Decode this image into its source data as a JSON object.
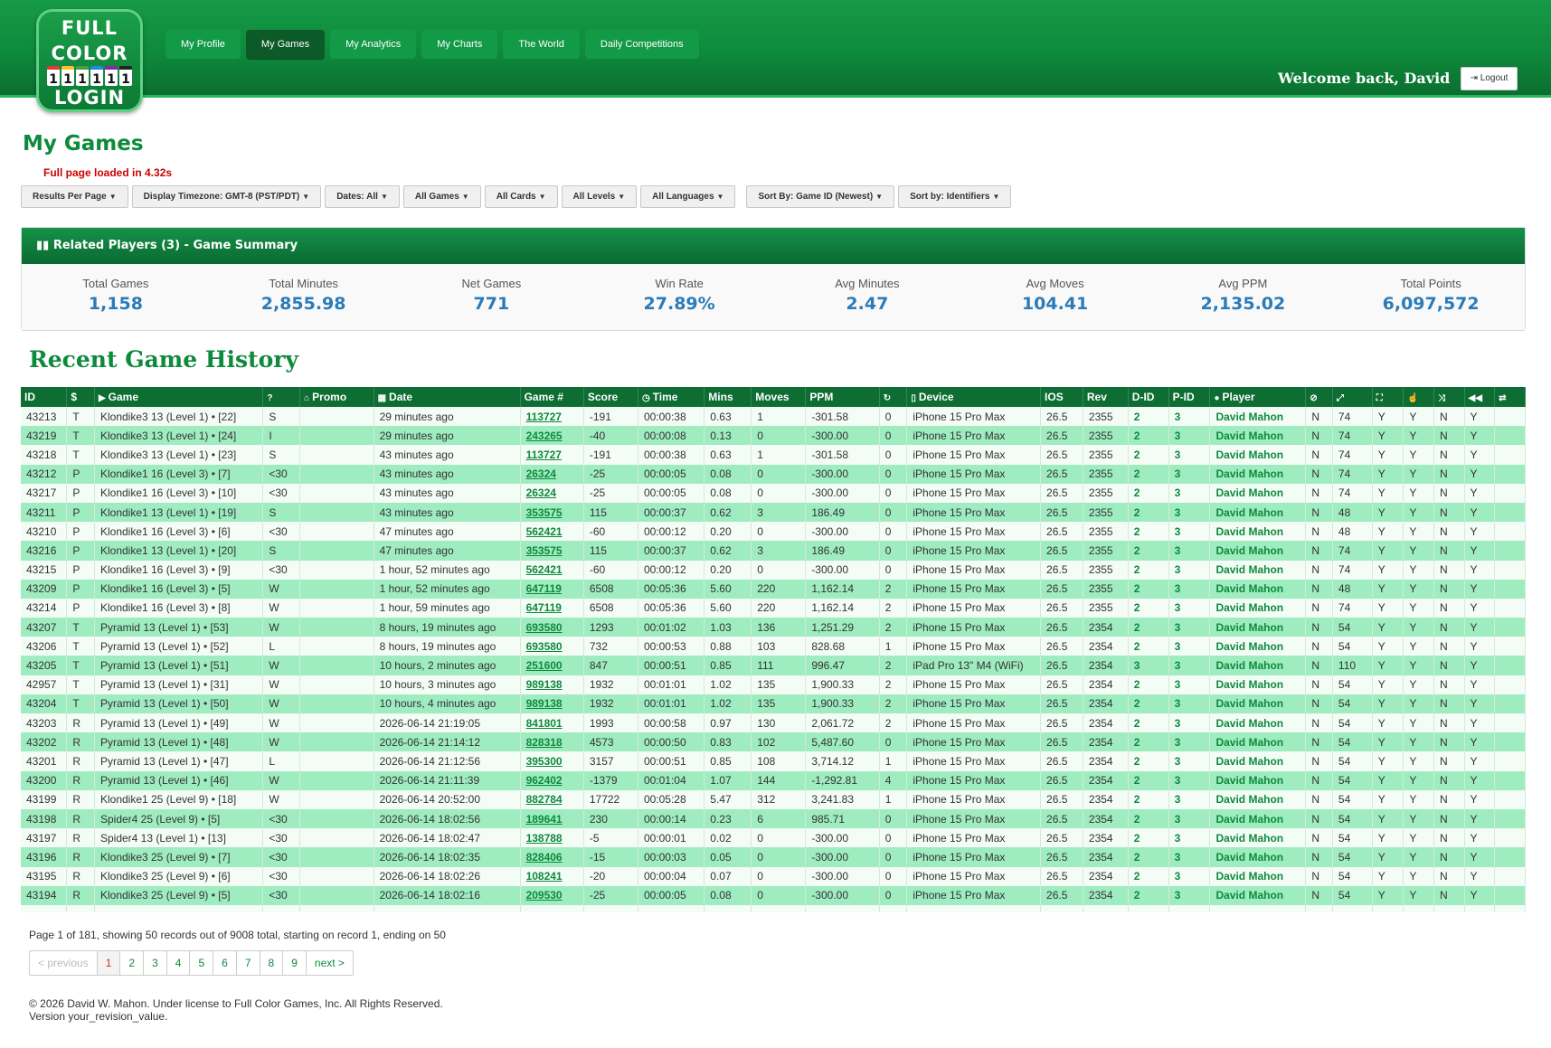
{
  "logo": {
    "line1": "FULL",
    "line2": "COLOR",
    "cards": [
      "1",
      "1",
      "1",
      "1",
      "1",
      "1"
    ],
    "line3": "LOGIN"
  },
  "nav": [
    {
      "label": "My Profile",
      "active": false
    },
    {
      "label": "My Games",
      "active": true
    },
    {
      "label": "My Analytics",
      "active": false
    },
    {
      "label": "My Charts",
      "active": false
    },
    {
      "label": "The World",
      "active": false
    },
    {
      "label": "Daily Competitions",
      "active": false
    }
  ],
  "header": {
    "welcome": "Welcome back, David",
    "logout_label": "Logout"
  },
  "page": {
    "title": "My Games",
    "load_time": "Full page loaded in 4.32s",
    "history_title": "Recent Game History"
  },
  "filters": [
    "Results Per Page",
    "Display Timezone: GMT-8 (PST/PDT)",
    "Dates: All",
    "All Games",
    "All Cards",
    "All Levels",
    "All Languages",
    "Sort By: Game ID (Newest)",
    "Sort by: Identifiers"
  ],
  "summary": {
    "title": "Related Players (3) - Game Summary",
    "stats": [
      {
        "label": "Total Games",
        "value": "1,158"
      },
      {
        "label": "Total Minutes",
        "value": "2,855.98"
      },
      {
        "label": "Net Games",
        "value": "771"
      },
      {
        "label": "Win Rate",
        "value": "27.89%"
      },
      {
        "label": "Avg Minutes",
        "value": "2.47"
      },
      {
        "label": "Avg Moves",
        "value": "104.41"
      },
      {
        "label": "Avg PPM",
        "value": "2,135.02"
      },
      {
        "label": "Total Points",
        "value": "6,097,572"
      }
    ]
  },
  "table": {
    "columns": [
      {
        "label": "ID",
        "icon": ""
      },
      {
        "label": "$",
        "icon": ""
      },
      {
        "label": "Game",
        "icon": "play-icon"
      },
      {
        "label": "",
        "icon": "question-icon"
      },
      {
        "label": "Promo",
        "icon": "tag-icon"
      },
      {
        "label": "Date",
        "icon": "calendar-icon"
      },
      {
        "label": "Game #",
        "icon": ""
      },
      {
        "label": "Score",
        "icon": ""
      },
      {
        "label": "Time",
        "icon": "clock-icon"
      },
      {
        "label": "Mins",
        "icon": ""
      },
      {
        "label": "Moves",
        "icon": ""
      },
      {
        "label": "PPM",
        "icon": ""
      },
      {
        "label": "",
        "icon": "refresh-icon"
      },
      {
        "label": "Device",
        "icon": "phone-icon"
      },
      {
        "label": "IOS",
        "icon": ""
      },
      {
        "label": "Rev",
        "icon": ""
      },
      {
        "label": "D-ID",
        "icon": ""
      },
      {
        "label": "P-ID",
        "icon": ""
      },
      {
        "label": "Player",
        "icon": "user-icon"
      },
      {
        "label": "",
        "icon": "ban-icon"
      },
      {
        "label": "",
        "icon": "resize-icon"
      },
      {
        "label": "",
        "icon": "fullscreen-icon"
      },
      {
        "label": "",
        "icon": "hand-icon"
      },
      {
        "label": "",
        "icon": "shuffle-icon"
      },
      {
        "label": "",
        "icon": "rewind-icon"
      },
      {
        "label": "",
        "icon": "swap-icon"
      }
    ],
    "rows": [
      [
        "43213",
        "T",
        "Klondike3 13 (Level 1) • [22]",
        "S",
        "",
        "29 minutes ago",
        "113727",
        "-191",
        "00:00:38",
        "0.63",
        "1",
        "-301.58",
        "0",
        "iPhone 15 Pro Max",
        "26.5",
        "2355",
        "2",
        "3",
        "David Mahon",
        "N",
        "74",
        "Y",
        "Y",
        "N",
        "Y",
        ""
      ],
      [
        "43219",
        "T",
        "Klondike3 13 (Level 1) • [24]",
        "I",
        "",
        "29 minutes ago",
        "243265",
        "-40",
        "00:00:08",
        "0.13",
        "0",
        "-300.00",
        "0",
        "iPhone 15 Pro Max",
        "26.5",
        "2355",
        "2",
        "3",
        "David Mahon",
        "N",
        "74",
        "Y",
        "Y",
        "N",
        "Y",
        ""
      ],
      [
        "43218",
        "T",
        "Klondike3 13 (Level 1) • [23]",
        "S",
        "",
        "43 minutes ago",
        "113727",
        "-191",
        "00:00:38",
        "0.63",
        "1",
        "-301.58",
        "0",
        "iPhone 15 Pro Max",
        "26.5",
        "2355",
        "2",
        "3",
        "David Mahon",
        "N",
        "74",
        "Y",
        "Y",
        "N",
        "Y",
        ""
      ],
      [
        "43212",
        "P",
        "Klondike1 16 (Level 3) • [7]",
        "<30",
        "",
        "43 minutes ago",
        "26324",
        "-25",
        "00:00:05",
        "0.08",
        "0",
        "-300.00",
        "0",
        "iPhone 15 Pro Max",
        "26.5",
        "2355",
        "2",
        "3",
        "David Mahon",
        "N",
        "74",
        "Y",
        "Y",
        "N",
        "Y",
        ""
      ],
      [
        "43217",
        "P",
        "Klondike1 16 (Level 3) • [10]",
        "<30",
        "",
        "43 minutes ago",
        "26324",
        "-25",
        "00:00:05",
        "0.08",
        "0",
        "-300.00",
        "0",
        "iPhone 15 Pro Max",
        "26.5",
        "2355",
        "2",
        "3",
        "David Mahon",
        "N",
        "74",
        "Y",
        "Y",
        "N",
        "Y",
        ""
      ],
      [
        "43211",
        "P",
        "Klondike1 13 (Level 1) • [19]",
        "S",
        "",
        "43 minutes ago",
        "353575",
        "115",
        "00:00:37",
        "0.62",
        "3",
        "186.49",
        "0",
        "iPhone 15 Pro Max",
        "26.5",
        "2355",
        "2",
        "3",
        "David Mahon",
        "N",
        "48",
        "Y",
        "Y",
        "N",
        "Y",
        ""
      ],
      [
        "43210",
        "P",
        "Klondike1 16 (Level 3) • [6]",
        "<30",
        "",
        "47 minutes ago",
        "562421",
        "-60",
        "00:00:12",
        "0.20",
        "0",
        "-300.00",
        "0",
        "iPhone 15 Pro Max",
        "26.5",
        "2355",
        "2",
        "3",
        "David Mahon",
        "N",
        "48",
        "Y",
        "Y",
        "N",
        "Y",
        ""
      ],
      [
        "43216",
        "P",
        "Klondike1 13 (Level 1) • [20]",
        "S",
        "",
        "47 minutes ago",
        "353575",
        "115",
        "00:00:37",
        "0.62",
        "3",
        "186.49",
        "0",
        "iPhone 15 Pro Max",
        "26.5",
        "2355",
        "2",
        "3",
        "David Mahon",
        "N",
        "74",
        "Y",
        "Y",
        "N",
        "Y",
        ""
      ],
      [
        "43215",
        "P",
        "Klondike1 16 (Level 3) • [9]",
        "<30",
        "",
        "1 hour, 52 minutes ago",
        "562421",
        "-60",
        "00:00:12",
        "0.20",
        "0",
        "-300.00",
        "0",
        "iPhone 15 Pro Max",
        "26.5",
        "2355",
        "2",
        "3",
        "David Mahon",
        "N",
        "74",
        "Y",
        "Y",
        "N",
        "Y",
        ""
      ],
      [
        "43209",
        "P",
        "Klondike1 16 (Level 3) • [5]",
        "W",
        "",
        "1 hour, 52 minutes ago",
        "647119",
        "6508",
        "00:05:36",
        "5.60",
        "220",
        "1,162.14",
        "2",
        "iPhone 15 Pro Max",
        "26.5",
        "2355",
        "2",
        "3",
        "David Mahon",
        "N",
        "48",
        "Y",
        "Y",
        "N",
        "Y",
        ""
      ],
      [
        "43214",
        "P",
        "Klondike1 16 (Level 3) • [8]",
        "W",
        "",
        "1 hour, 59 minutes ago",
        "647119",
        "6508",
        "00:05:36",
        "5.60",
        "220",
        "1,162.14",
        "2",
        "iPhone 15 Pro Max",
        "26.5",
        "2355",
        "2",
        "3",
        "David Mahon",
        "N",
        "74",
        "Y",
        "Y",
        "N",
        "Y",
        ""
      ],
      [
        "43207",
        "T",
        "Pyramid 13 (Level 1) • [53]",
        "W",
        "",
        "8 hours, 19 minutes ago",
        "693580",
        "1293",
        "00:01:02",
        "1.03",
        "136",
        "1,251.29",
        "2",
        "iPhone 15 Pro Max",
        "26.5",
        "2354",
        "2",
        "3",
        "David Mahon",
        "N",
        "54",
        "Y",
        "Y",
        "N",
        "Y",
        ""
      ],
      [
        "43206",
        "T",
        "Pyramid 13 (Level 1) • [52]",
        "L",
        "",
        "8 hours, 19 minutes ago",
        "693580",
        "732",
        "00:00:53",
        "0.88",
        "103",
        "828.68",
        "1",
        "iPhone 15 Pro Max",
        "26.5",
        "2354",
        "2",
        "3",
        "David Mahon",
        "N",
        "54",
        "Y",
        "Y",
        "N",
        "Y",
        ""
      ],
      [
        "43205",
        "T",
        "Pyramid 13 (Level 1) • [51]",
        "W",
        "",
        "10 hours, 2 minutes ago",
        "251600",
        "847",
        "00:00:51",
        "0.85",
        "111",
        "996.47",
        "2",
        "iPad Pro 13\" M4 (WiFi)",
        "26.5",
        "2354",
        "3",
        "3",
        "David Mahon",
        "N",
        "110",
        "Y",
        "Y",
        "N",
        "Y",
        ""
      ],
      [
        "42957",
        "T",
        "Pyramid 13 (Level 1) • [31]",
        "W",
        "",
        "10 hours, 3 minutes ago",
        "989138",
        "1932",
        "00:01:01",
        "1.02",
        "135",
        "1,900.33",
        "2",
        "iPhone 15 Pro Max",
        "26.5",
        "2354",
        "2",
        "3",
        "David Mahon",
        "N",
        "54",
        "Y",
        "Y",
        "N",
        "Y",
        ""
      ],
      [
        "43204",
        "T",
        "Pyramid 13 (Level 1) • [50]",
        "W",
        "",
        "10 hours, 4 minutes ago",
        "989138",
        "1932",
        "00:01:01",
        "1.02",
        "135",
        "1,900.33",
        "2",
        "iPhone 15 Pro Max",
        "26.5",
        "2354",
        "2",
        "3",
        "David Mahon",
        "N",
        "54",
        "Y",
        "Y",
        "N",
        "Y",
        ""
      ],
      [
        "43203",
        "R",
        "Pyramid 13 (Level 1) • [49]",
        "W",
        "",
        "2026-06-14 21:19:05",
        "841801",
        "1993",
        "00:00:58",
        "0.97",
        "130",
        "2,061.72",
        "2",
        "iPhone 15 Pro Max",
        "26.5",
        "2354",
        "2",
        "3",
        "David Mahon",
        "N",
        "54",
        "Y",
        "Y",
        "N",
        "Y",
        ""
      ],
      [
        "43202",
        "R",
        "Pyramid 13 (Level 1) • [48]",
        "W",
        "",
        "2026-06-14 21:14:12",
        "828318",
        "4573",
        "00:00:50",
        "0.83",
        "102",
        "5,487.60",
        "0",
        "iPhone 15 Pro Max",
        "26.5",
        "2354",
        "2",
        "3",
        "David Mahon",
        "N",
        "54",
        "Y",
        "Y",
        "N",
        "Y",
        ""
      ],
      [
        "43201",
        "R",
        "Pyramid 13 (Level 1) • [47]",
        "L",
        "",
        "2026-06-14 21:12:56",
        "395300",
        "3157",
        "00:00:51",
        "0.85",
        "108",
        "3,714.12",
        "1",
        "iPhone 15 Pro Max",
        "26.5",
        "2354",
        "2",
        "3",
        "David Mahon",
        "N",
        "54",
        "Y",
        "Y",
        "N",
        "Y",
        ""
      ],
      [
        "43200",
        "R",
        "Pyramid 13 (Level 1) • [46]",
        "W",
        "",
        "2026-06-14 21:11:39",
        "962402",
        "-1379",
        "00:01:04",
        "1.07",
        "144",
        "-1,292.81",
        "4",
        "iPhone 15 Pro Max",
        "26.5",
        "2354",
        "2",
        "3",
        "David Mahon",
        "N",
        "54",
        "Y",
        "Y",
        "N",
        "Y",
        ""
      ],
      [
        "43199",
        "R",
        "Klondike1 25 (Level 9) • [18]",
        "W",
        "",
        "2026-06-14 20:52:00",
        "882784",
        "17722",
        "00:05:28",
        "5.47",
        "312",
        "3,241.83",
        "1",
        "iPhone 15 Pro Max",
        "26.5",
        "2354",
        "2",
        "3",
        "David Mahon",
        "N",
        "54",
        "Y",
        "Y",
        "N",
        "Y",
        ""
      ],
      [
        "43198",
        "R",
        "Spider4 25 (Level 9) • [5]",
        "<30",
        "",
        "2026-06-14 18:02:56",
        "189641",
        "230",
        "00:00:14",
        "0.23",
        "6",
        "985.71",
        "0",
        "iPhone 15 Pro Max",
        "26.5",
        "2354",
        "2",
        "3",
        "David Mahon",
        "N",
        "54",
        "Y",
        "Y",
        "N",
        "Y",
        ""
      ],
      [
        "43197",
        "R",
        "Spider4 13 (Level 1) • [13]",
        "<30",
        "",
        "2026-06-14 18:02:47",
        "138788",
        "-5",
        "00:00:01",
        "0.02",
        "0",
        "-300.00",
        "0",
        "iPhone 15 Pro Max",
        "26.5",
        "2354",
        "2",
        "3",
        "David Mahon",
        "N",
        "54",
        "Y",
        "Y",
        "N",
        "Y",
        ""
      ],
      [
        "43196",
        "R",
        "Klondike3 25 (Level 9) • [7]",
        "<30",
        "",
        "2026-06-14 18:02:35",
        "828406",
        "-15",
        "00:00:03",
        "0.05",
        "0",
        "-300.00",
        "0",
        "iPhone 15 Pro Max",
        "26.5",
        "2354",
        "2",
        "3",
        "David Mahon",
        "N",
        "54",
        "Y",
        "Y",
        "N",
        "Y",
        ""
      ],
      [
        "43195",
        "R",
        "Klondike3 25 (Level 9) • [6]",
        "<30",
        "",
        "2026-06-14 18:02:26",
        "108241",
        "-20",
        "00:00:04",
        "0.07",
        "0",
        "-300.00",
        "0",
        "iPhone 15 Pro Max",
        "26.5",
        "2354",
        "2",
        "3",
        "David Mahon",
        "N",
        "54",
        "Y",
        "Y",
        "N",
        "Y",
        ""
      ],
      [
        "43194",
        "R",
        "Klondike3 25 (Level 9) • [5]",
        "<30",
        "",
        "2026-06-14 18:02:16",
        "209530",
        "-25",
        "00:00:05",
        "0.08",
        "0",
        "-300.00",
        "0",
        "iPhone 15 Pro Max",
        "26.5",
        "2354",
        "2",
        "3",
        "David Mahon",
        "N",
        "54",
        "Y",
        "Y",
        "N",
        "Y",
        ""
      ]
    ]
  },
  "pagination": {
    "info": "Page 1 of 181, showing 50 records out of 9008 total, starting on record 1, ending on 50",
    "previous": "< previous",
    "pages": [
      "1",
      "2",
      "3",
      "4",
      "5",
      "6",
      "7",
      "8",
      "9"
    ],
    "current": "1",
    "next": "next >"
  },
  "footer": {
    "copyright": "© 2026 David W. Mahon. Under license to Full Color Games, Inc. All Rights Reserved.",
    "version": "Version your_revision_value."
  }
}
